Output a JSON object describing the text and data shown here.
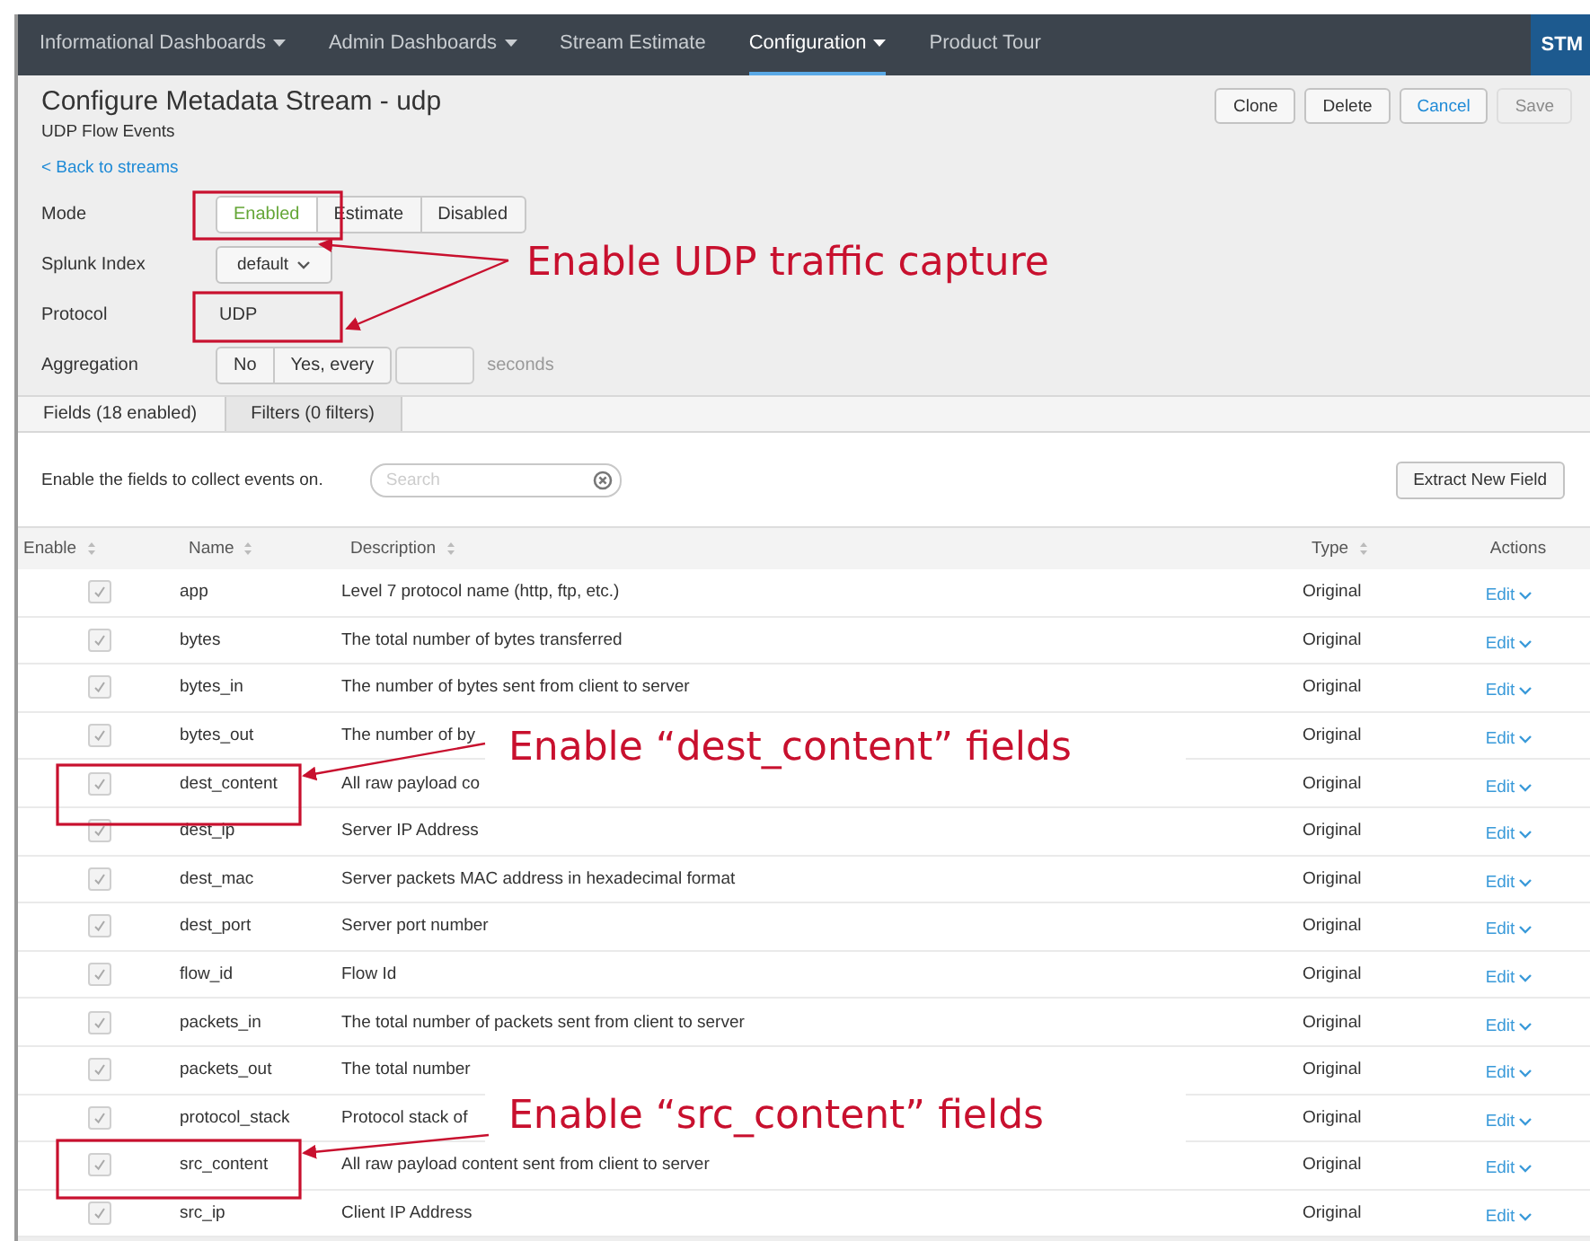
{
  "nav": {
    "items": [
      {
        "label": "Informational Dashboards",
        "dropdown": true,
        "selected": false
      },
      {
        "label": "Admin Dashboards",
        "dropdown": true,
        "selected": false
      },
      {
        "label": "Stream Estimate",
        "dropdown": false,
        "selected": false
      },
      {
        "label": "Configuration",
        "dropdown": true,
        "selected": true
      },
      {
        "label": "Product Tour",
        "dropdown": false,
        "selected": false
      }
    ],
    "app_badge": "STM"
  },
  "header": {
    "title": "Configure Metadata Stream - udp",
    "subtitle": "UDP Flow Events",
    "back_link": "< Back to streams",
    "buttons": [
      {
        "label": "Clone",
        "kind": "default",
        "disabled": false
      },
      {
        "label": "Delete",
        "kind": "default",
        "disabled": false
      },
      {
        "label": "Cancel",
        "kind": "link",
        "disabled": false
      },
      {
        "label": "Save",
        "kind": "default",
        "disabled": true
      }
    ]
  },
  "form": [
    {
      "label": "Mode",
      "kind": "segmented",
      "options": [
        {
          "label": "Enabled",
          "selected": true
        },
        {
          "label": "Estimate",
          "selected": false
        },
        {
          "label": "Disabled",
          "selected": false
        }
      ]
    },
    {
      "label": "Splunk Index",
      "kind": "dropdown",
      "value": "default"
    },
    {
      "label": "Protocol",
      "kind": "text",
      "value": "UDP"
    },
    {
      "label": "Aggregation",
      "kind": "aggregation",
      "options": [
        {
          "label": "No",
          "selected": false
        },
        {
          "label": "Yes, every",
          "selected": false
        }
      ],
      "unit": "seconds"
    }
  ],
  "tabs": [
    {
      "label": "Fields (18 enabled)",
      "selected": true
    },
    {
      "label": "Filters (0 filters)",
      "selected": false
    }
  ],
  "fields_toolbar": {
    "hint": "Enable the fields to collect events on.",
    "search": {
      "placeholder": "Search"
    },
    "button": "Extract New Field"
  },
  "table": {
    "columns": [
      {
        "label": "Enable",
        "sortable": true
      },
      {
        "label": "Name",
        "sortable": true
      },
      {
        "label": "Description",
        "sortable": true
      },
      {
        "label": "Type",
        "sortable": true
      },
      {
        "label": "Actions",
        "sortable": false
      }
    ],
    "rows": [
      {
        "checked": true,
        "name": "app",
        "description": "Level 7 protocol name (http, ftp, etc.)",
        "type": "Original",
        "action": "Edit"
      },
      {
        "checked": true,
        "name": "bytes",
        "description": "The total number of bytes transferred",
        "type": "Original",
        "action": "Edit"
      },
      {
        "checked": true,
        "name": "bytes_in",
        "description": "The number of bytes sent from client to server",
        "type": "Original",
        "action": "Edit"
      },
      {
        "checked": true,
        "name": "bytes_out",
        "description": "The number of by",
        "type": "Original",
        "action": "Edit"
      },
      {
        "checked": true,
        "name": "dest_content",
        "description": "All raw payload co",
        "type": "Original",
        "action": "Edit"
      },
      {
        "checked": true,
        "name": "dest_ip",
        "description": "Server IP Address",
        "type": "Original",
        "action": "Edit"
      },
      {
        "checked": true,
        "name": "dest_mac",
        "description": "Server packets MAC address in hexadecimal format",
        "type": "Original",
        "action": "Edit"
      },
      {
        "checked": true,
        "name": "dest_port",
        "description": "Server port number",
        "type": "Original",
        "action": "Edit"
      },
      {
        "checked": true,
        "name": "flow_id",
        "description": "Flow Id",
        "type": "Original",
        "action": "Edit"
      },
      {
        "checked": true,
        "name": "packets_in",
        "description": "The total number of packets sent from client to server",
        "type": "Original",
        "action": "Edit"
      },
      {
        "checked": true,
        "name": "packets_out",
        "description": "The total number",
        "type": "Original",
        "action": "Edit"
      },
      {
        "checked": true,
        "name": "protocol_stack",
        "description": "Protocol stack of",
        "type": "Original",
        "action": "Edit"
      },
      {
        "checked": true,
        "name": "src_content",
        "description": "All raw payload content sent from client to server",
        "type": "Original",
        "action": "Edit"
      },
      {
        "checked": true,
        "name": "src_ip",
        "description": "Client IP Address",
        "type": "Original",
        "action": "Edit"
      }
    ]
  },
  "annotations": [
    {
      "text": "Enable UDP traffic capture"
    },
    {
      "text": "Enable “dest_content” fields"
    },
    {
      "text": "Enable “src_content” fields"
    }
  ]
}
